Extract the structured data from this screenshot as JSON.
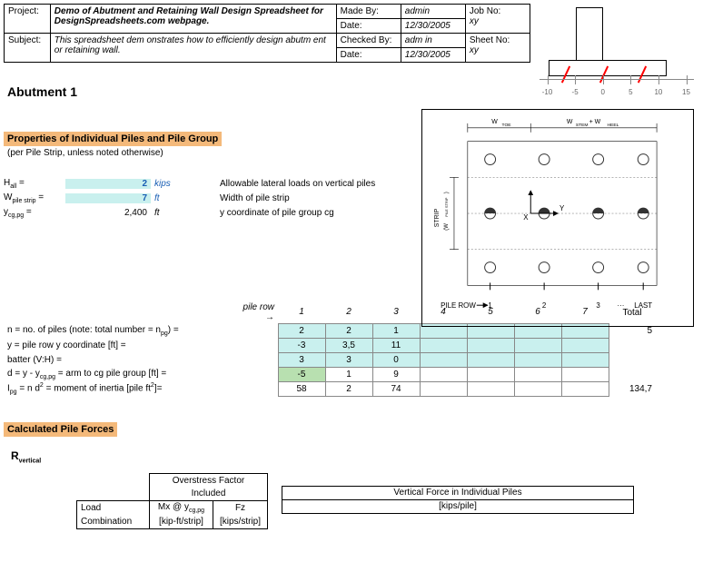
{
  "header": {
    "projectLbl": "Project:",
    "projectVal": "Demo of Abutment and Retaining Wall Design Spreadsheet for DesignSpreadsheets.com webpage.",
    "subjectLbl": "Subject:",
    "subjectVal": "This spreadsheet dem onstrates how to efficiently design abutm ent or retaining wall.",
    "madeByLbl": "Made By:",
    "madeByVal": "admin",
    "dateLbl1": "Date:",
    "dateVal1": "12/30/2005",
    "checkedByLbl": "Checked By:",
    "checkedByVal": "adm in",
    "dateLbl2": "Date:",
    "dateVal2": "12/30/2005",
    "jobNoLbl": "Job No:",
    "jobNoVal": "xy",
    "sheetNoLbl": "Sheet No:",
    "sheetNoVal": "xy"
  },
  "axis": {
    "ticks": [
      "-10",
      "-5",
      "0",
      "5",
      "10",
      "15"
    ]
  },
  "title1": "Abutment 1",
  "propsHdr": "Properties of Individual Piles and Pile Group",
  "propsSub": "(per Pile Strip, unless noted otherwise)",
  "props": {
    "hall": {
      "label": "Hₐₗₗ =",
      "labelPlain": "H",
      "labelSub": "all",
      "eq": " =",
      "value": "2",
      "unit": "kips",
      "desc": "Allowable lateral loads on vertical piles"
    },
    "wps": {
      "labelPlain": "W",
      "labelSub": "pile strip",
      "eq": " =",
      "value": "7",
      "unit": "ft",
      "desc": "Width of pile strip"
    },
    "ycg": {
      "labelPlain": "y",
      "labelSub": "cg,pg",
      "eq": " =",
      "value": "2,400",
      "unit": "ft",
      "desc": "y coordinate of pile group cg"
    }
  },
  "diagramLabels": {
    "wtoe": "W",
    "wtoeSub": "TOE",
    "wstem": "W",
    "wstemSub": "STEM",
    "plus": " + W",
    "wheelSub": "HEEL",
    "strip": "STRIP",
    "wps": "(W",
    "wpsSub": "PILE STRIP",
    "wpsEnd": ")",
    "x": "X",
    "y": "Y",
    "pileRow": "PILE ROW",
    "arrow": "→",
    "r1": "1",
    "r2": "2",
    "r3": "3",
    "dots": "···",
    "last": "LAST"
  },
  "tableHdr": {
    "pilerow": "pile row →",
    "c1": "1",
    "c2": "2",
    "c3": "3",
    "c4": "4",
    "c5": "5",
    "c6": "6",
    "c7": "7",
    "total": "Total"
  },
  "tableRows": {
    "n": {
      "desc": "n = no. of piles (note: total number = n",
      "descSub": "pg",
      "descEnd": ") =",
      "v": [
        "2",
        "2",
        "1",
        "",
        "",
        "",
        ""
      ],
      "total": "5"
    },
    "y": {
      "desc": "y = pile row y coordinate [ft] =",
      "v": [
        "-3",
        "3,5",
        "11",
        "",
        "",
        "",
        ""
      ]
    },
    "b": {
      "desc": "batter (V:H) =",
      "v": [
        "3",
        "3",
        "0",
        "",
        "",
        "",
        ""
      ]
    },
    "d": {
      "desc": "d = y - y",
      "descSub": "cg,pg",
      "descEnd": " = arm to cg pile group [ft] =",
      "v": [
        "-5",
        "1",
        "9",
        "",
        "",
        "",
        ""
      ]
    },
    "I": {
      "desc": "I",
      "descSub": "pg",
      "descMid": " = n d",
      "descSup": "2",
      "descEnd": " = moment of inertia [pile ft",
      "descSup2": "2",
      "descEnd2": "]=",
      "v": [
        "58",
        "2",
        "74",
        "",
        "",
        "",
        ""
      ],
      "total": "134,7"
    }
  },
  "calcHdr": "Calculated Pile Forces",
  "rvert": "R",
  "rvertSub": "vertical",
  "loadTable": {
    "over1": "Overstress Factor",
    "over2": "Included",
    "load": "Load",
    "comb": "Combination",
    "mx": "Mx @ y",
    "mxSub": "cg,pg",
    "mxu": "[kip-ft/strip]",
    "fz": "Fz",
    "fzu": "[kips/strip]"
  },
  "vfTable": {
    "title": "Vertical Force in Individual Piles",
    "unit": "[kips/pile]"
  }
}
